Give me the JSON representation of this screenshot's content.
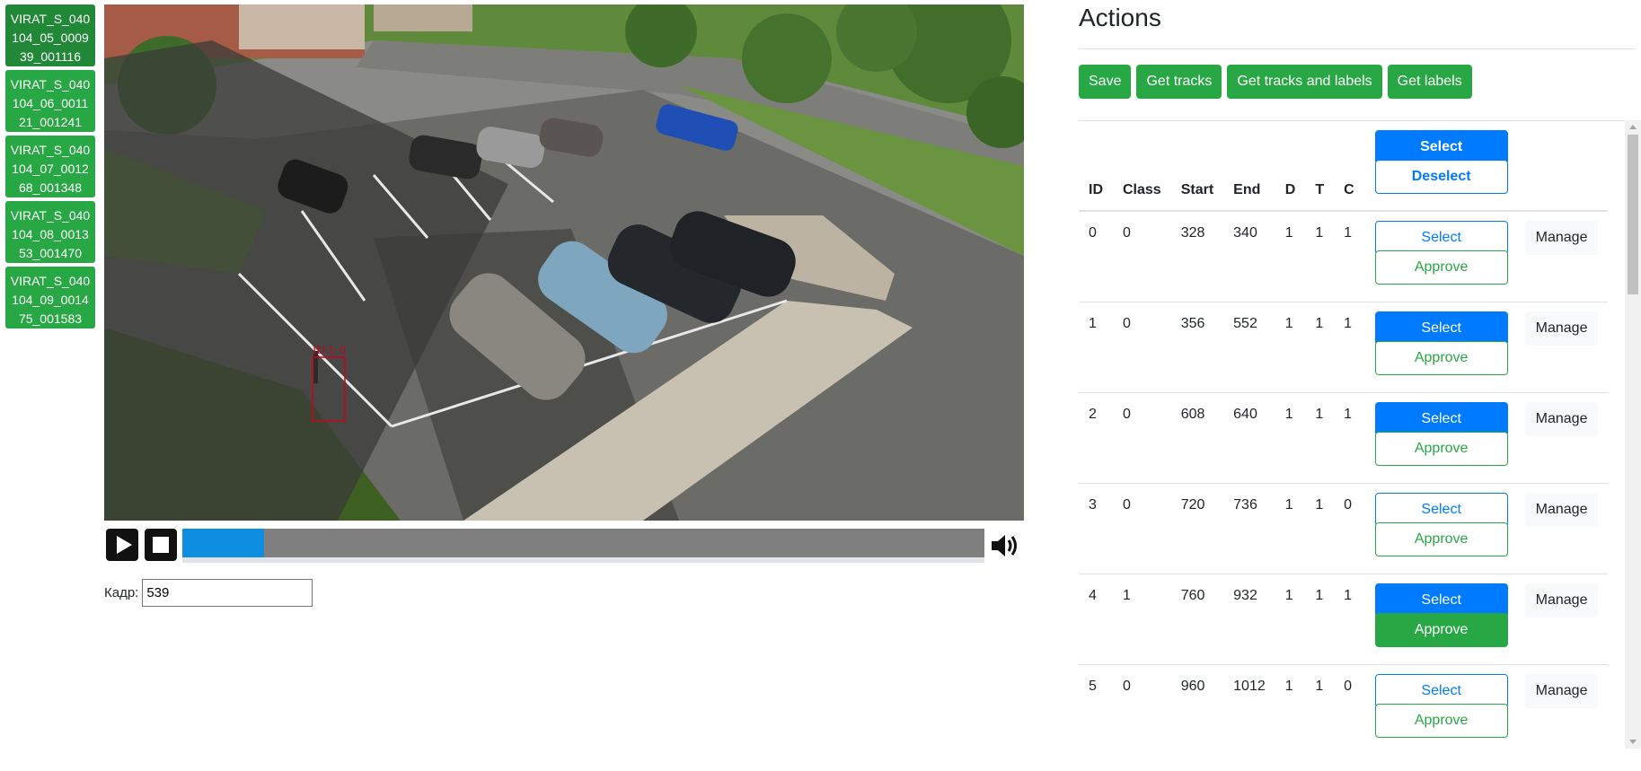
{
  "video_list": [
    {
      "label": "VIRAT_S_040\n104_05_0009\n39_001116",
      "active": true
    },
    {
      "label": "VIRAT_S_040\n104_06_0011\n21_001241",
      "active": false
    },
    {
      "label": "VIRAT_S_040\n104_07_0012\n68_001348",
      "active": false
    },
    {
      "label": "VIRAT_S_040\n104_08_0013\n53_001470",
      "active": false
    },
    {
      "label": "VIRAT_S_040\n104_09_0014\n75_001583",
      "active": false
    }
  ],
  "video": {
    "overlay_label": "ID 1: 0",
    "progress_fraction": 0.102
  },
  "frame": {
    "label": "Кадр:",
    "value": "539"
  },
  "actions": {
    "title": "Actions",
    "buttons": [
      "Save",
      "Get tracks",
      "Get tracks and labels",
      "Get labels"
    ]
  },
  "table": {
    "headers": {
      "id": "ID",
      "class": "Class",
      "start": "Start",
      "end": "End",
      "d": "D",
      "t": "T",
      "c": "C"
    },
    "header_select_label": "Select",
    "header_deselect_label": "Deselect",
    "select_label": "Select",
    "approve_label": "Approve",
    "manage_label": "Manage",
    "rows": [
      {
        "id": "0",
        "class": "0",
        "start": "328",
        "end": "340",
        "d": "1",
        "t": "1",
        "c": "1",
        "selected": false,
        "approved": false
      },
      {
        "id": "1",
        "class": "0",
        "start": "356",
        "end": "552",
        "d": "1",
        "t": "1",
        "c": "1",
        "selected": true,
        "approved": false
      },
      {
        "id": "2",
        "class": "0",
        "start": "608",
        "end": "640",
        "d": "1",
        "t": "1",
        "c": "1",
        "selected": true,
        "approved": false
      },
      {
        "id": "3",
        "class": "0",
        "start": "720",
        "end": "736",
        "d": "1",
        "t": "1",
        "c": "0",
        "selected": false,
        "approved": false
      },
      {
        "id": "4",
        "class": "1",
        "start": "760",
        "end": "932",
        "d": "1",
        "t": "1",
        "c": "1",
        "selected": true,
        "approved": true
      },
      {
        "id": "5",
        "class": "0",
        "start": "960",
        "end": "1012",
        "d": "1",
        "t": "1",
        "c": "0",
        "selected": false,
        "approved": false
      }
    ]
  },
  "colors": {
    "success": "#28a745",
    "primary": "#007bff",
    "bbox": "#d0021b"
  }
}
